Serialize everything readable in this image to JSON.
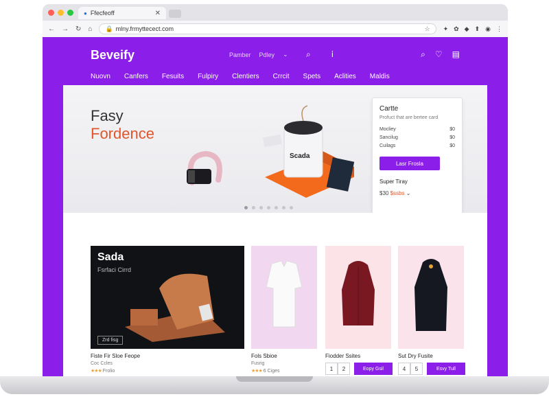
{
  "browser": {
    "tab_title": "Ffecfeoff",
    "url": "mlny.frmyttecect.com",
    "dots": [
      "#ff5f57",
      "#febc2e",
      "#28c840"
    ]
  },
  "site": {
    "brand": "Beveify",
    "header_links": [
      "Pamber",
      "Pdley"
    ],
    "nav": [
      "Nuovn",
      "Canfers",
      "Fesuits",
      "Fulpiry",
      "Clentiers",
      "Crrcit",
      "Spets",
      "Aclities",
      "Maldis"
    ],
    "accent": "#8b1ee8",
    "orange": "#e0562a"
  },
  "hero": {
    "title_line1": "Fasy",
    "title_line2": "Fordence",
    "carousel_count": 7,
    "carousel_active": 0,
    "card": {
      "title": "Cartte",
      "subtitle": "Profuct that are bertee card",
      "rows": [
        {
          "label": "Mocliey",
          "value": "$0"
        },
        {
          "label": "Sancilug",
          "value": "$0"
        },
        {
          "label": "Cuilags",
          "value": "$0"
        }
      ],
      "button": "Lasr Frosla",
      "label": "Super Tiray",
      "price": "$30",
      "price_accent": "$ssbs"
    }
  },
  "feature": {
    "title": "Sada",
    "subtitle": "Fsrfaci Cirrd",
    "tag": "Zrd fisg",
    "name": "Fiste Fir Sloe Feope",
    "meta": "Coc Ccles",
    "meta2": "Frolio"
  },
  "products": [
    {
      "name": "Fols Sbioe",
      "meta": "Fusrig",
      "meta2": "6 Ciges",
      "has_qty": false
    },
    {
      "name": "Fiodder Ssites",
      "qty": [
        "1",
        "2"
      ],
      "button": "Eopy Gsil",
      "has_qty": true
    },
    {
      "name": "Sut Dry Fusite",
      "qty": [
        "4",
        "5"
      ],
      "button": "Esvy Tull",
      "has_qty": true
    }
  ]
}
